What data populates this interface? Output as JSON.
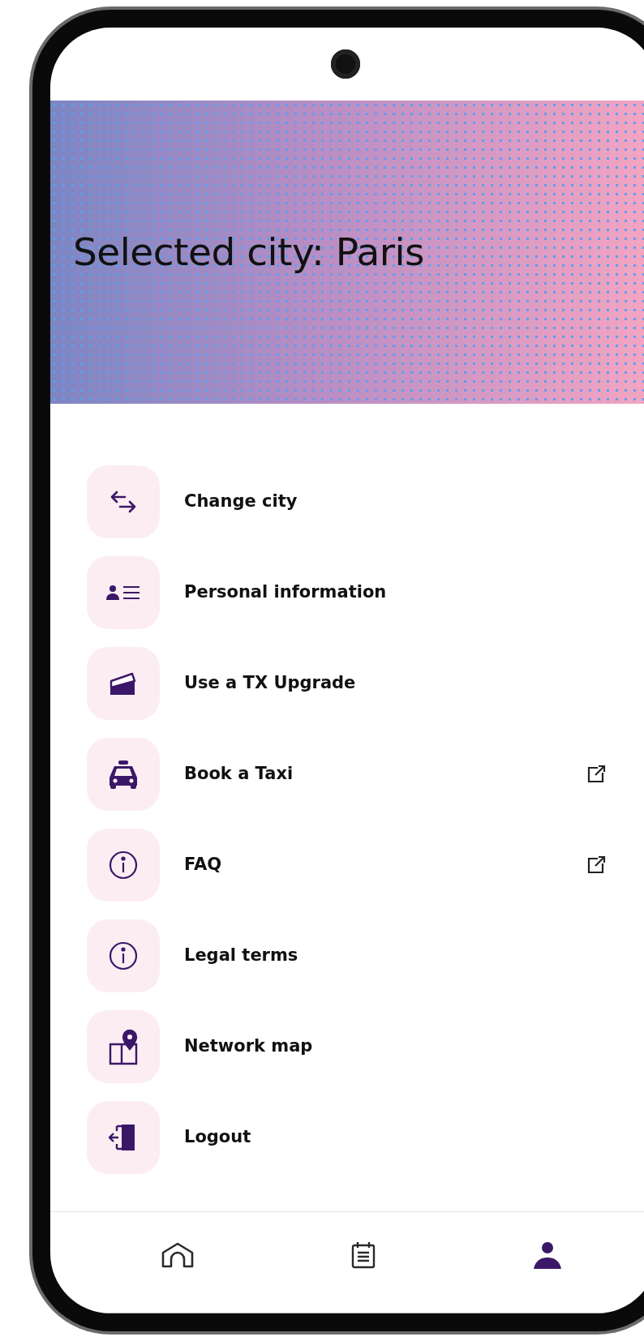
{
  "header": {
    "title": "Selected city: Paris"
  },
  "menu": [
    {
      "kind": "swap",
      "label": "Change city",
      "external": false
    },
    {
      "kind": "id-card",
      "label": "Personal information",
      "external": false
    },
    {
      "kind": "ticket",
      "label": "Use a TX Upgrade",
      "external": false
    },
    {
      "kind": "taxi",
      "label": "Book a Taxi",
      "external": true
    },
    {
      "kind": "info",
      "label": "FAQ",
      "external": true
    },
    {
      "kind": "info",
      "label": "Legal terms",
      "external": false
    },
    {
      "kind": "map",
      "label": "Network map",
      "external": false
    },
    {
      "kind": "logout",
      "label": "Logout",
      "external": false
    }
  ],
  "bottom_nav": [
    {
      "kind": "home",
      "selected": false
    },
    {
      "kind": "calendar",
      "selected": false
    },
    {
      "kind": "profile",
      "selected": true
    }
  ]
}
